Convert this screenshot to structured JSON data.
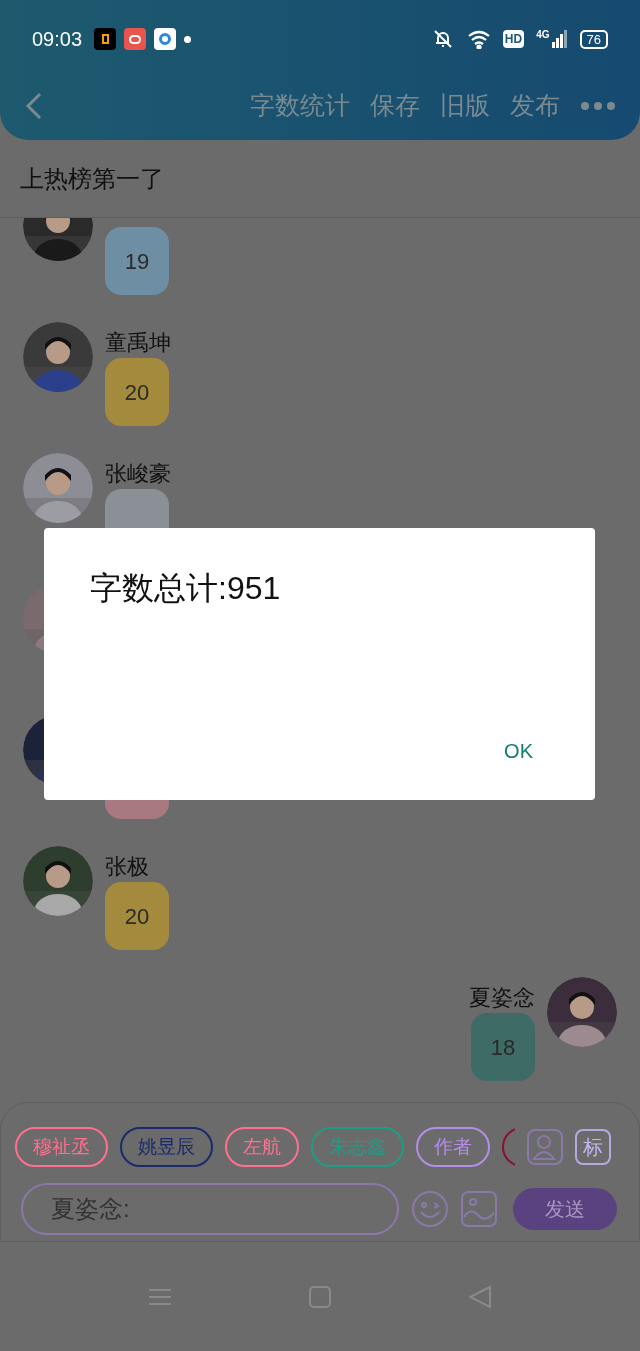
{
  "status_bar": {
    "time": "09:03",
    "hd": "HD",
    "network": "4G",
    "battery": "76"
  },
  "toolbar": {
    "actions": [
      "字数统计",
      "保存",
      "旧版",
      "发布"
    ]
  },
  "title": "上热榜第一了",
  "messages": [
    {
      "kind": "incoming",
      "value": "19",
      "color": "#6d8ea3"
    },
    {
      "kind": "incoming",
      "name": "童禹坤",
      "value": "20",
      "color": "#a48a3c"
    },
    {
      "kind": "incoming",
      "name": "张峻豪",
      "color": "#8a9096"
    },
    {
      "kind": "incoming"
    },
    {
      "kind": "incoming",
      "color": "#a87a80"
    },
    {
      "kind": "incoming",
      "name": "张极",
      "value": "20",
      "color": "#a48a3c"
    },
    {
      "kind": "outgoing",
      "name": "夏姿念",
      "value": "18",
      "color": "#3f6b66"
    }
  ],
  "role_chips": [
    {
      "label": "穆祉丞",
      "color": "#ff7090"
    },
    {
      "label": "姚昱辰",
      "color": "#1b2a6b"
    },
    {
      "label": "左航",
      "color": "#ff7090"
    },
    {
      "label": "朱志鑫",
      "color": "#1e9e86"
    },
    {
      "label": "作者",
      "color": "#b48ee8"
    },
    {
      "color": "#8a1030"
    }
  ],
  "tag_button": "标",
  "input": {
    "placeholder": "夏姿念:"
  },
  "send_button": "发送",
  "dialog": {
    "message": "字数总计:951",
    "ok": "OK"
  }
}
